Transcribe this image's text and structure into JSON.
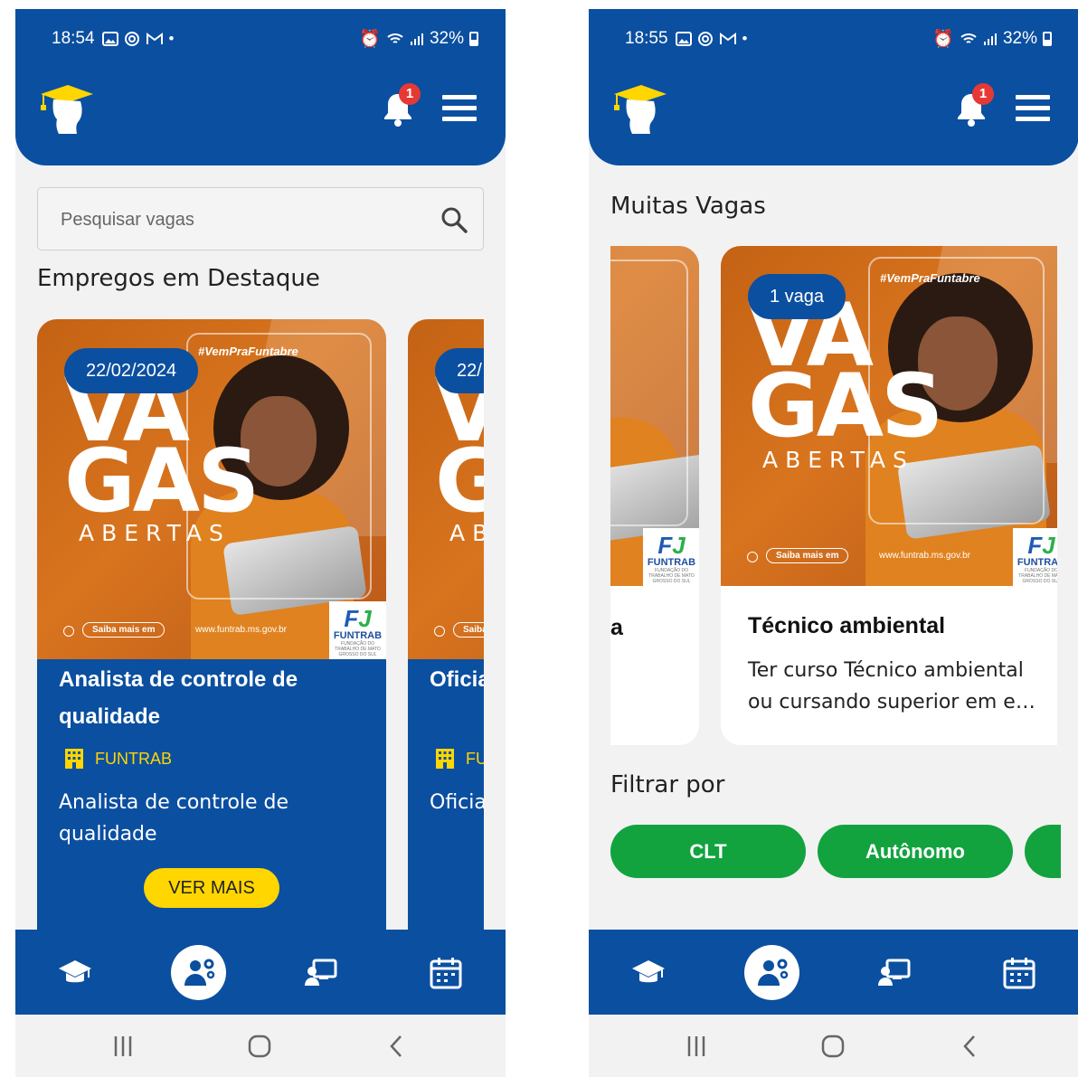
{
  "left_screen": {
    "status": {
      "time": "18:54",
      "battery": "32%"
    },
    "notifications": {
      "count": "1"
    },
    "search": {
      "placeholder": "Pesquisar vagas"
    },
    "section_title": "Empregos em Destaque",
    "cards": [
      {
        "date": "22/02/2024",
        "title": "Analista de controle de qualidade",
        "company": "FUNTRAB",
        "description": "Analista de controle de qualidade",
        "button": "VER MAIS"
      },
      {
        "date": "22/",
        "title": "Oficia",
        "company": "FU",
        "description": "Oficia"
      }
    ]
  },
  "right_screen": {
    "status": {
      "time": "18:55",
      "battery": "32%"
    },
    "notifications": {
      "count": "1"
    },
    "section_title": "Muitas Vagas",
    "cards": [
      {
        "title": "a"
      },
      {
        "badge": "1 vaga",
        "title": "Técnico ambiental",
        "description": "Ter curso Técnico ambiental ou cursando superior em e…"
      }
    ],
    "filter_title": "Filtrar por",
    "filters": [
      "CLT",
      "Autônomo",
      ""
    ]
  },
  "poster": {
    "tag": "#VemPraFuntabre",
    "line1": "VA",
    "line2": "GAS",
    "line3": "ABERTAS",
    "cta": "Saiba mais em",
    "url": "www.funtrab.ms.gov.br",
    "brand": "FUNTRAB",
    "brand_sub": "FUNDAÇÃO DO TRABALHO DE MATO GROSSO DO SUL"
  },
  "nav_icons": [
    "graduation-cap-icon",
    "worker-gears-icon",
    "teacher-board-icon",
    "calendar-icon"
  ],
  "colors": {
    "primary": "#0b4fa0",
    "accent": "#ffd600",
    "filter": "#12a33f",
    "badge": "#e53935",
    "poster": "#d8741e"
  }
}
